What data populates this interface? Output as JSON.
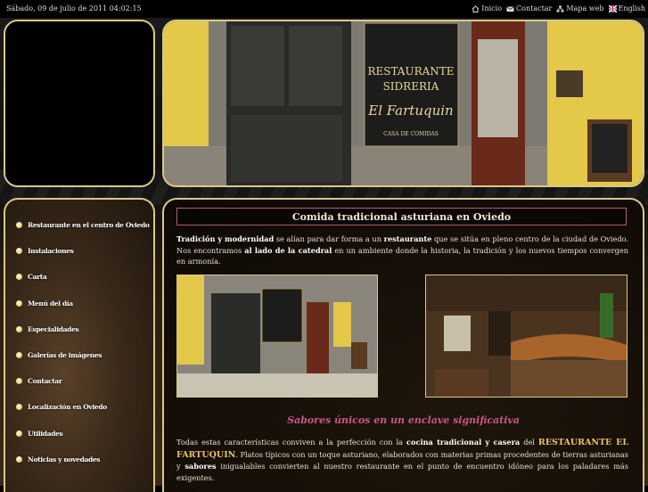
{
  "topbar": {
    "datetime": "Sábado, 09 de julio de 2011 04:02:15",
    "links": [
      {
        "label": "Inicio",
        "icon": "home-icon"
      },
      {
        "label": "Contactar",
        "icon": "mail-icon"
      },
      {
        "label": "Mapa web",
        "icon": "sitemap-icon"
      },
      {
        "label": "English",
        "icon": "uk-flag-icon"
      }
    ]
  },
  "header": {
    "sign_line1": "RESTAURANTE",
    "sign_line2": "SIDRERIA",
    "sign_line3": "El Fartuquin",
    "sign_line4": "CASA DE COMIDAS"
  },
  "sidebar": {
    "items": [
      {
        "label": "Restaurante en el centro de Oviedo"
      },
      {
        "label": "Instalaciones"
      },
      {
        "label": "Carta"
      },
      {
        "label": "Menú del día"
      },
      {
        "label": "Especialidades"
      },
      {
        "label": "Galerías de imágenes"
      },
      {
        "label": "Contactar"
      },
      {
        "label": "Localización en Oviedo"
      },
      {
        "label": "Utilidades"
      },
      {
        "label": "Noticias y novedades"
      }
    ]
  },
  "main": {
    "title": "Comida tradicional asturiana en Oviedo",
    "intro": {
      "b1": "Tradición y modernidad",
      "t1": " se alían para dar forma a un ",
      "b2": "restaurante",
      "t2": " que se sitúa en pleno centro de la ciudad de Oviedo. Nos encontramos ",
      "b3": "al lado de la catedral",
      "t3": " en un ambiente donde la historia, la tradición y los nuevos tiempos convergen en armonía."
    },
    "subtitle": "Sabores únicos en un enclave significativa",
    "body": {
      "t1": "Todas estas características conviven a la perfección con la ",
      "b1": "cocina tradicional y casera",
      "t2": " del ",
      "brand": "RESTAURANTE EL FARTUQUIN",
      "t3": ". Platos típicos con un toque asturiano, elaborados con materias primas procedentes de tierras asturianas y ",
      "b2": "sabores",
      "t4": " inigualables convierten al nuestro restaurante en el punto de encuentro idóneo para los paladares más exigentes."
    }
  },
  "colors": {
    "accent_border": "#d9c88a",
    "title_border": "#b35a78",
    "subtitle": "#c7578a",
    "brand": "#e8c36a"
  }
}
